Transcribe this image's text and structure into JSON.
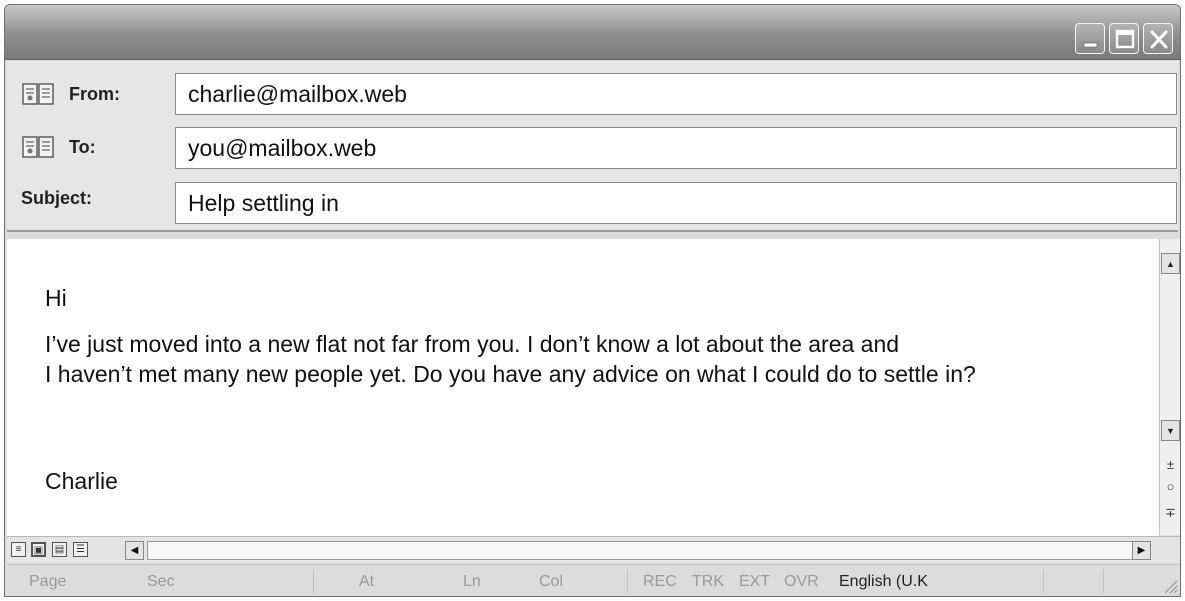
{
  "header": {
    "from_label": "From:",
    "from_value": "charlie@mailbox.web",
    "to_label": "To:",
    "to_value": "you@mailbox.web",
    "subject_label": "Subject:",
    "subject_value": "Help settling in"
  },
  "body": {
    "greeting": "Hi",
    "line1": "I’ve just moved into a new flat not far from you. I don’t know a lot about the area and",
    "line2": "I haven’t met many new people yet. Do you have any advice on what I could do to settle in?",
    "signoff": "Charlie"
  },
  "statusbar": {
    "page": "Page",
    "sec": "Sec",
    "at": "At",
    "ln": "Ln",
    "col": "Col",
    "rec": "REC",
    "trk": "TRK",
    "ext": "EXT",
    "ovr": "OVR",
    "language": "English (U.K"
  },
  "icons": {
    "address_book": "address-book-icon",
    "minimize": "minimize-icon",
    "maximize": "maximize-icon",
    "close": "close-icon"
  },
  "colors": {
    "titlebar": "#8e8e8e",
    "window": "#dcdcdc",
    "text": "#111111"
  }
}
